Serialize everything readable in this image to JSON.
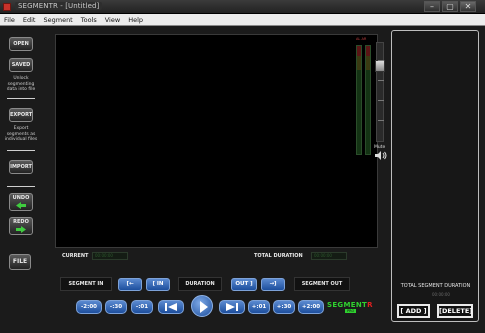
{
  "window": {
    "title": "SEGMENTR - [Untitled]",
    "buttons": {
      "minimize": "–",
      "maximize": "▢",
      "close": "✕"
    }
  },
  "menu": [
    "File",
    "Edit",
    "Segment",
    "Tools",
    "View",
    "Help"
  ],
  "sidebar": {
    "open_label": "OPEN",
    "saved_label": "SAVED",
    "saved_note": "Unlock segmenting data into file",
    "export_label": "EXPORT",
    "export_note": "Export segments as individual files",
    "import_label": "IMPORT",
    "undo_label": "UNDO",
    "redo_label": "REDO",
    "file_label": "FILE"
  },
  "meters": {
    "label": "AL AR"
  },
  "volume": {
    "mute_label": "Mute"
  },
  "info": {
    "current_label": "CURRENT",
    "current_value": "00:00:00",
    "total_label": "TOTAL DURATION",
    "total_value": "00:00:00"
  },
  "segment": {
    "in_label": "SEGMENT IN",
    "duration_label": "DURATION",
    "out_label": "SEGMENT OUT",
    "set_in_btn": "[←",
    "go_in_btn": "[ IN",
    "go_out_btn": "OUT ]",
    "set_out_btn": "→]"
  },
  "transport": {
    "back_2min": "-2:00",
    "back_30": "-:30",
    "back_01": "-:01",
    "fwd_01": "+:01",
    "fwd_30": "+:30",
    "fwd_2min": "+2:00"
  },
  "logo": {
    "main": "SEGMENT",
    "accent": "R",
    "sub": "PRO"
  },
  "right_panel": {
    "total_segment_label": "TOTAL SEGMENT DURATION",
    "total_segment_value": "00:00:00",
    "add_label": "[ ADD ]",
    "delete_label": "[DELETE]"
  },
  "colors": {
    "accent_blue": "#2a5eb0",
    "logo_green": "#2fd12f",
    "logo_red": "#e02020"
  }
}
